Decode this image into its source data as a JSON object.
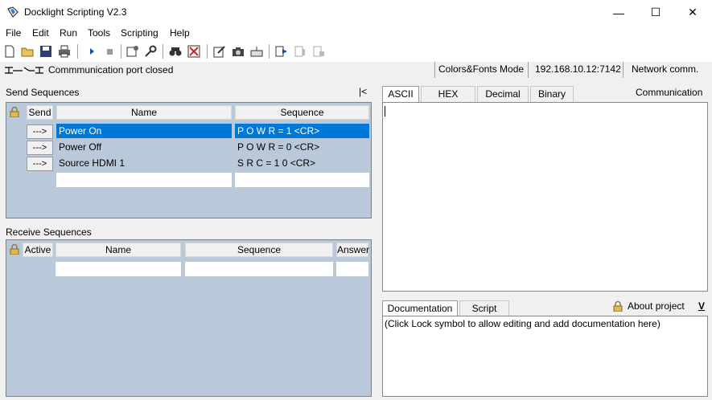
{
  "window": {
    "title": "Docklight Scripting V2.3"
  },
  "controls": {
    "minimize": "—",
    "maximize": "☐",
    "close": "✕"
  },
  "menu": [
    "File",
    "Edit",
    "Run",
    "Tools",
    "Scripting",
    "Help"
  ],
  "status": {
    "port": "Commmunication port closed",
    "mode": "Colors&Fonts Mode",
    "address": "192.168.10.12:7142",
    "connection": "Network comm."
  },
  "send": {
    "title": "Send Sequences",
    "collapse": "|<",
    "headers": {
      "send": "Send",
      "name": "Name",
      "sequence": "Sequence"
    },
    "button_label": "--->",
    "rows": [
      {
        "name": "Power On",
        "sequence": "P O W R = 1 <CR>"
      },
      {
        "name": "Power Off",
        "sequence": "P O W R = 0 <CR>"
      },
      {
        "name": "Source HDMI 1",
        "sequence": "S R C = 1 0 <CR>"
      }
    ]
  },
  "receive": {
    "title": "Receive Sequences",
    "headers": {
      "active": "Active",
      "name": "Name",
      "sequence": "Sequence",
      "answer": "Answer"
    }
  },
  "communication": {
    "title": "Communication",
    "tabs": [
      "ASCII",
      "HEX",
      "Decimal",
      "Binary"
    ]
  },
  "docs": {
    "tabs": [
      "Documentation",
      "Script"
    ],
    "about": "About project",
    "toggle": "V",
    "placeholder": "(Click Lock symbol to allow editing and add documentation here)"
  }
}
